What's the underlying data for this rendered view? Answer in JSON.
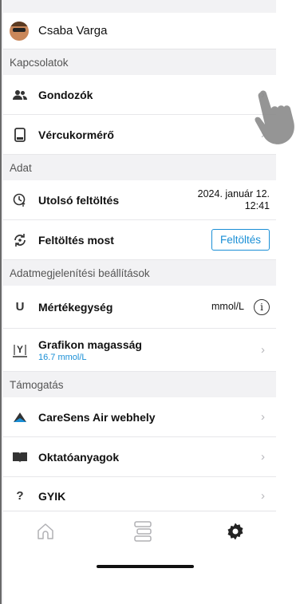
{
  "profile": {
    "name": "Csaba Varga"
  },
  "sections": {
    "connections": {
      "header": "Kapcsolatok",
      "items": [
        {
          "label": "Gondozók",
          "icon": "people-icon"
        },
        {
          "label": "Vércukormérő",
          "icon": "glucose-meter-icon"
        }
      ]
    },
    "data": {
      "header": "Adat",
      "last_upload": {
        "label": "Utolsó feltöltés",
        "value_line1": "2024. január 12.",
        "value_line2": "12:41",
        "icon": "clock-upload-icon"
      },
      "upload_now": {
        "label": "Feltöltés most",
        "button": "Feltöltés",
        "icon": "sync-icon"
      }
    },
    "display": {
      "header": "Adatmegjelenítési beállítások",
      "unit": {
        "label": "Mértékegység",
        "icon_text": "U",
        "value": "mmol/L",
        "info": "i"
      },
      "graph_height": {
        "label": "Grafikon magasság",
        "value": "16.7 mmol/L",
        "icon_text": "Y"
      }
    },
    "support": {
      "header": "Támogatás",
      "items": [
        {
          "label": "CareSens Air webhely",
          "icon": "caresens-logo-icon"
        },
        {
          "label": "Oktatóanyagok",
          "icon": "book-icon"
        },
        {
          "label": "GYIK",
          "icon_text": "?"
        }
      ]
    }
  },
  "tabs": [
    {
      "name": "home",
      "icon": "home-icon",
      "active": false
    },
    {
      "name": "list",
      "icon": "list-icon",
      "active": false
    },
    {
      "name": "settings",
      "icon": "gear-icon",
      "active": true
    }
  ],
  "colors": {
    "accent": "#1a8fd6",
    "background": "#f2f2f4"
  }
}
